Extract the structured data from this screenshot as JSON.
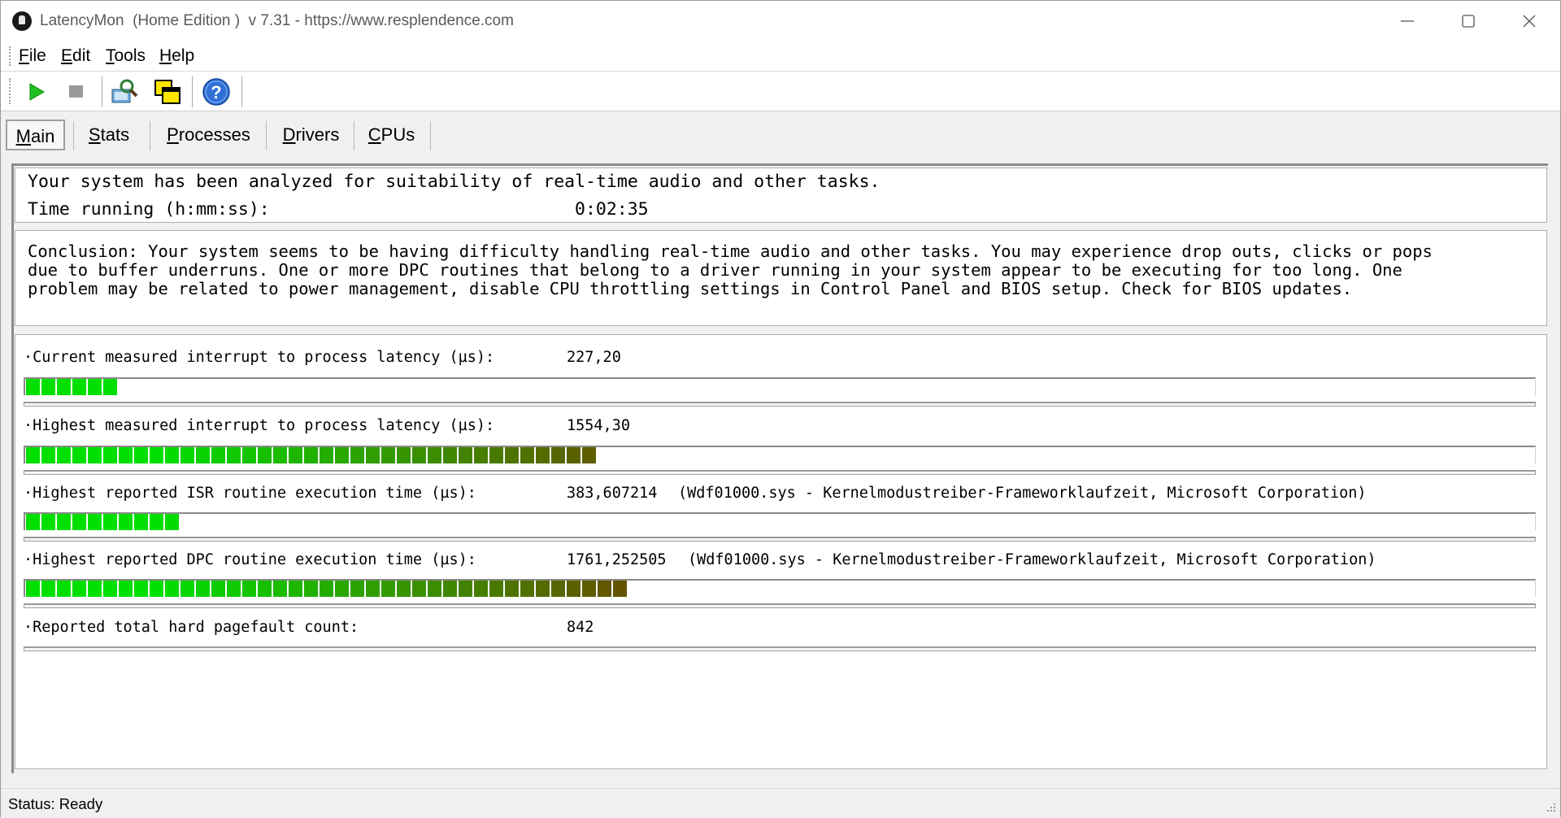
{
  "window": {
    "title": "LatencyMon  (Home Edition )  v 7.31 - https://www.resplendence.com"
  },
  "menu": {
    "items": [
      {
        "first": "F",
        "rest": "ile"
      },
      {
        "first": "E",
        "rest": "dit"
      },
      {
        "first": "T",
        "rest": "ools"
      },
      {
        "first": "H",
        "rest": "elp"
      }
    ]
  },
  "toolbar": {
    "buttons": [
      "play-icon",
      "stop-icon",
      "analyze-icon",
      "window-icon",
      "help-icon"
    ]
  },
  "tabs": {
    "items": [
      {
        "first": "M",
        "rest": "ain"
      },
      {
        "first": "S",
        "rest": "tats"
      },
      {
        "first": "P",
        "rest": "rocesses"
      },
      {
        "first": "D",
        "rest": "rivers"
      },
      {
        "first": "C",
        "rest": "PUs"
      }
    ],
    "active": "Main"
  },
  "summary": {
    "line1": "Your system has been analyzed for suitability of real-time audio and other tasks.",
    "time_label": "Time running (h:mm:ss):",
    "time_value": "0:02:35"
  },
  "conclusion": "Conclusion: Your system seems to be having difficulty handling real-time audio and other tasks. You may experience drop outs, clicks or pops\ndue to buffer underruns. One or more DPC routines that belong to a driver running in your system appear to be executing for too long. One\nproblem may be related to power management, disable CPU throttling settings in Control Panel and BIOS setup. Check for BIOS updates.",
  "metrics": [
    {
      "label": "·Current measured interrupt to process latency (µs):",
      "value": "227,20",
      "detail": "",
      "bar_segments": 6
    },
    {
      "label": "·Highest measured interrupt to process latency (µs):",
      "value": "1554,30",
      "detail": "",
      "bar_segments": 37
    },
    {
      "label": "·Highest reported ISR routine execution time (µs):",
      "value": "383,607214",
      "detail": "(Wdf01000.sys - Kernelmodustreiber-Frameworklaufzeit, Microsoft Corporation)",
      "bar_segments": 10
    },
    {
      "label": "·Highest reported DPC routine execution time (µs):",
      "value": "1761,252505",
      "detail": "(Wdf01000.sys - Kernelmodustreiber-Frameworklaufzeit, Microsoft Corporation)",
      "bar_segments": 39
    },
    {
      "label": "·Reported total hard pagefault count:",
      "value": "842",
      "detail": "",
      "bar_segments": null
    }
  ],
  "status": {
    "text": "Status: Ready"
  },
  "colors": {
    "bar_green": "#00e000",
    "bar_olive": "#6b4a00"
  }
}
